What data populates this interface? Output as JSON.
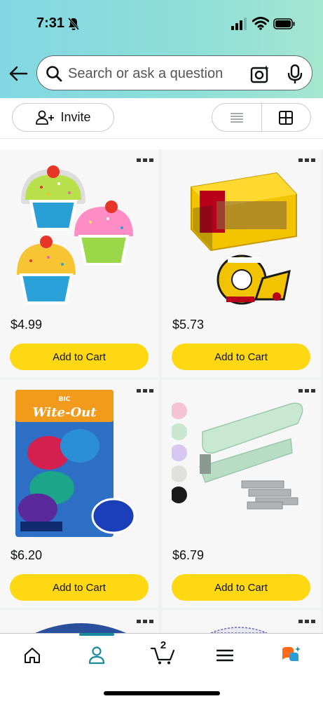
{
  "status_bar": {
    "time": "7:31"
  },
  "search": {
    "placeholder": "Search or ask a question"
  },
  "toolbar": {
    "invite_label": "Invite"
  },
  "products": [
    {
      "price": "$4.99",
      "add_to_cart": "Add to Cart",
      "image": "cupcake-cutouts"
    },
    {
      "price": "$5.73",
      "add_to_cart": "Add to Cart",
      "image": "scotch-double-sided-tape"
    },
    {
      "price": "$6.20",
      "add_to_cart": "Add to Cart",
      "image": "bic-wite-out-correction-tape",
      "image_text": {
        "brand": "BIC",
        "name": "Wite-Out"
      }
    },
    {
      "price": "$6.79",
      "add_to_cart": "Add to Cart",
      "image": "mint-stapler-with-staples"
    }
  ],
  "bottom_nav": {
    "cart_count": "2",
    "items": [
      "home-icon",
      "account-icon",
      "cart-icon",
      "menu-icon",
      "rufus-icon"
    ],
    "active": "account-icon"
  },
  "colors": {
    "accent": "#1b8a9c",
    "add_to_cart": "#ffd814",
    "header_gradient_start": "#82d8e2",
    "header_gradient_end": "#a6e6cf"
  }
}
